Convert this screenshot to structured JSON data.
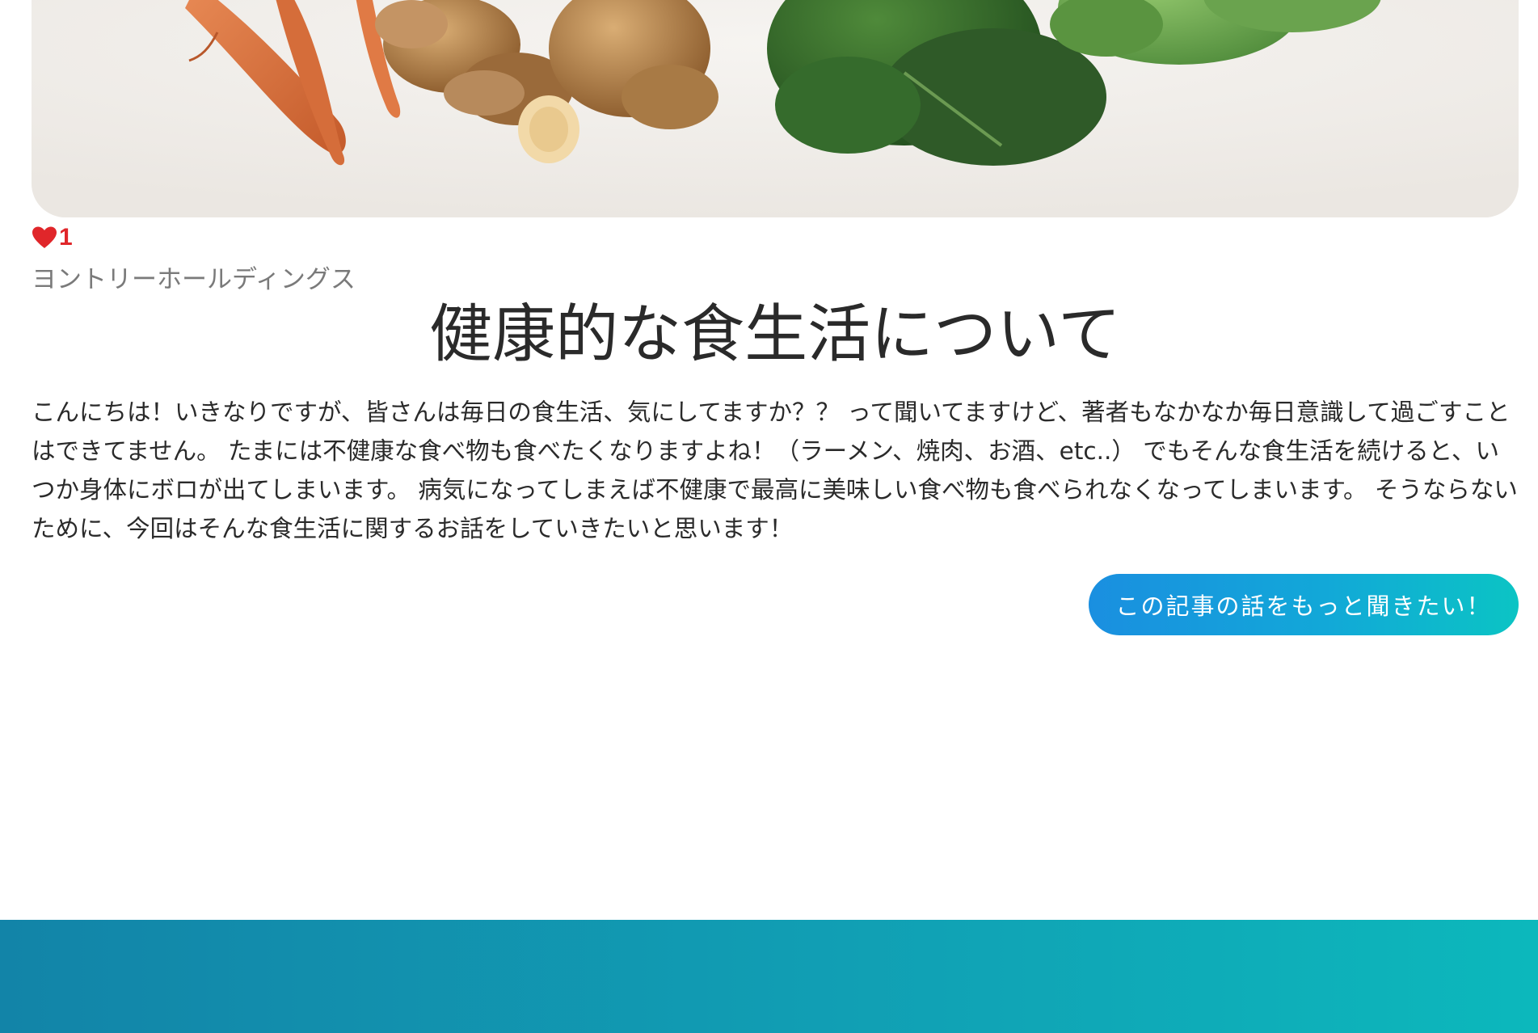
{
  "article": {
    "image_alt": "vegetables-and-nuts-photo",
    "likes": "1",
    "author": "ヨントリーホールディングス",
    "title": "健康的な食生活について",
    "body": "こんにちは！いきなりですが、皆さんは毎日の食生活、気にしてますか？？ って聞いてますけど、著者もなかなか毎日意識して過ごすことはできてません。 たまには不健康な食べ物も食べたくなりますよね！（ラーメン、焼肉、お酒、etc..） でもそんな食生活を続けると、いつか身体にボロが出てしまいます。 病気になってしまえば不健康で最高に美味しい食べ物も食べられなくなってしまいます。 そうならないために、今回はそんな食生活に関するお話をしていきたいと思います！",
    "cta_label": "この記事の話をもっと聞きたい！"
  },
  "colors": {
    "heart": "#e0262a",
    "author": "#7a7a7a",
    "cta_start": "#1a8fe0",
    "cta_end": "#0bc4c4",
    "footer_start": "#1284a8",
    "footer_end": "#0cb8bc"
  },
  "icons": {
    "like": "heart-icon"
  }
}
